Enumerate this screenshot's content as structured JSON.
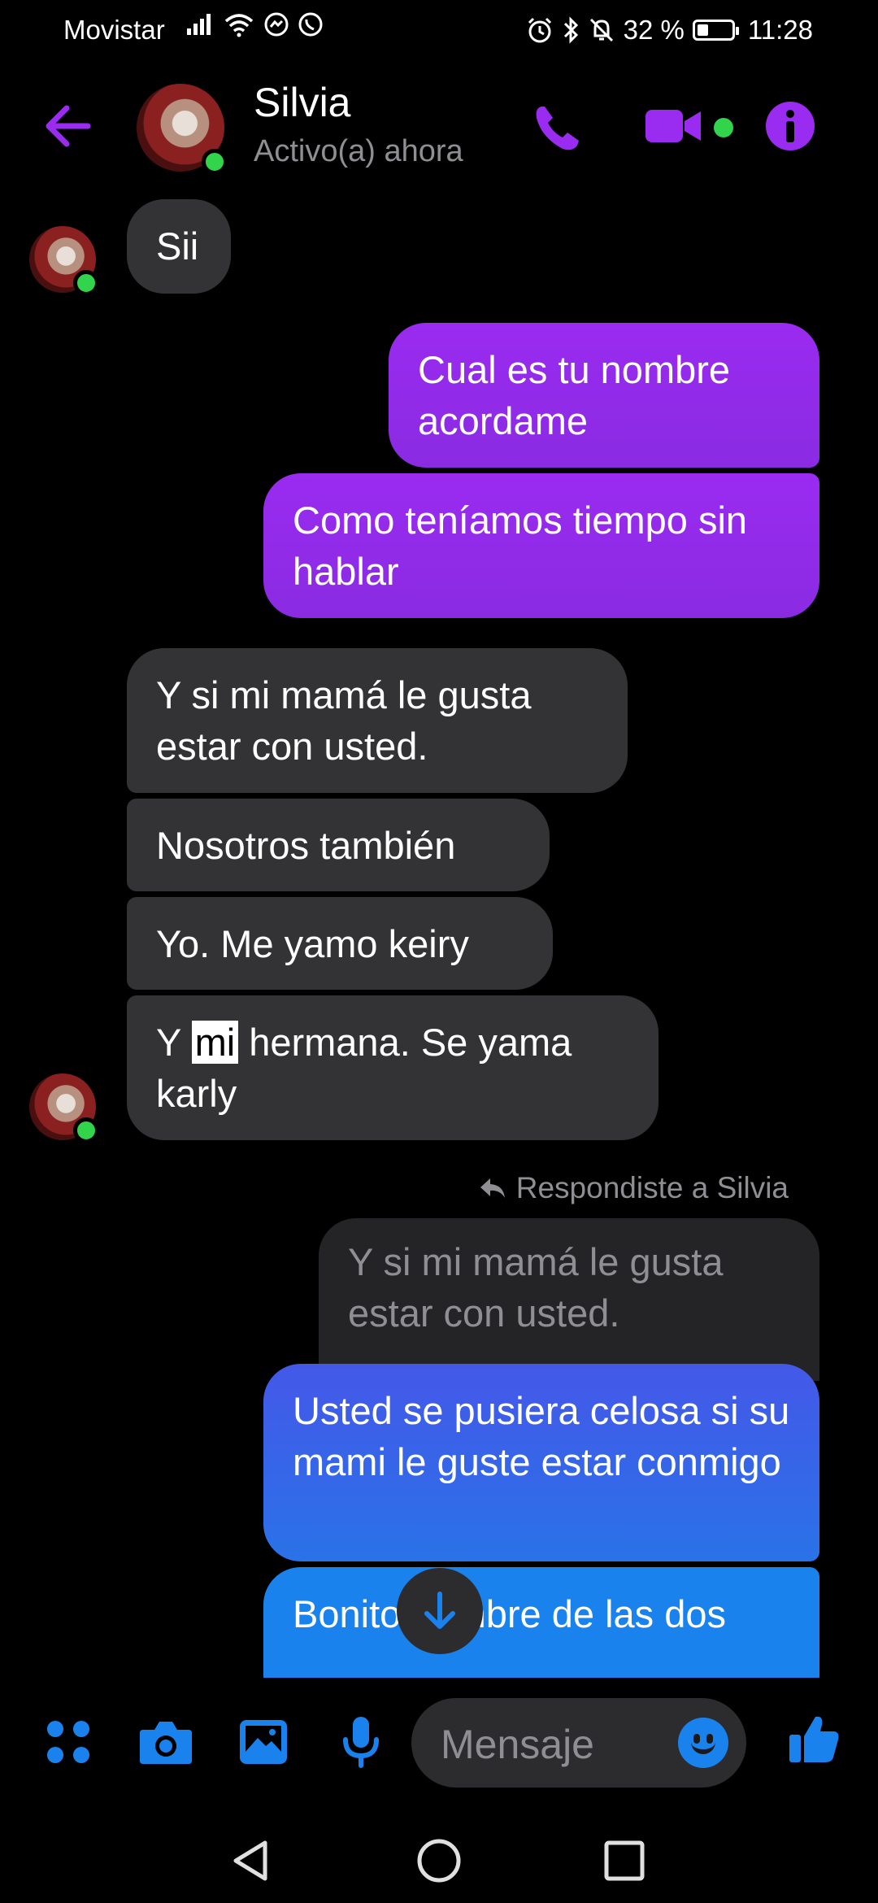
{
  "status_bar": {
    "carrier": "Movistar",
    "battery_percent": "32 %",
    "battery_level": 0.32,
    "time": "11:28"
  },
  "header": {
    "contact_name": "Silvia",
    "contact_status": "Activo(a) ahora",
    "icons": [
      "back-arrow-icon",
      "phone-icon",
      "video-call-icon",
      "info-icon"
    ]
  },
  "messages": {
    "m1": "Sii",
    "m2": "Cual es tu nombre acordame",
    "m3": "Como teníamos tiempo sin hablar",
    "m4": "Y si mi mamá le gusta estar con usted.",
    "m5": "Nosotros también",
    "m6": "Yo. Me yamo keiry",
    "m7_a": "Y ",
    "m7_hl": "mi",
    "m7_b": " hermana. Se yama karly",
    "reply_label": "Respondiste a Silvia",
    "quoted": "Y si mi mamá le gusta estar con usted.",
    "m8": "Usted se pusiera celosa si su mami le guste estar conmigo",
    "m9": "Bonito nombre de las dos"
  },
  "composer": {
    "placeholder": "Mensaje",
    "icons": [
      "apps-icon",
      "camera-icon",
      "gallery-icon",
      "microphone-icon",
      "emoji-icon",
      "thumbs-up-icon"
    ]
  },
  "colors": {
    "accent_purple": "#9a2bf0",
    "accent_blue": "#1a82ec",
    "incoming_bubble": "#333335",
    "online": "#31d44a"
  }
}
